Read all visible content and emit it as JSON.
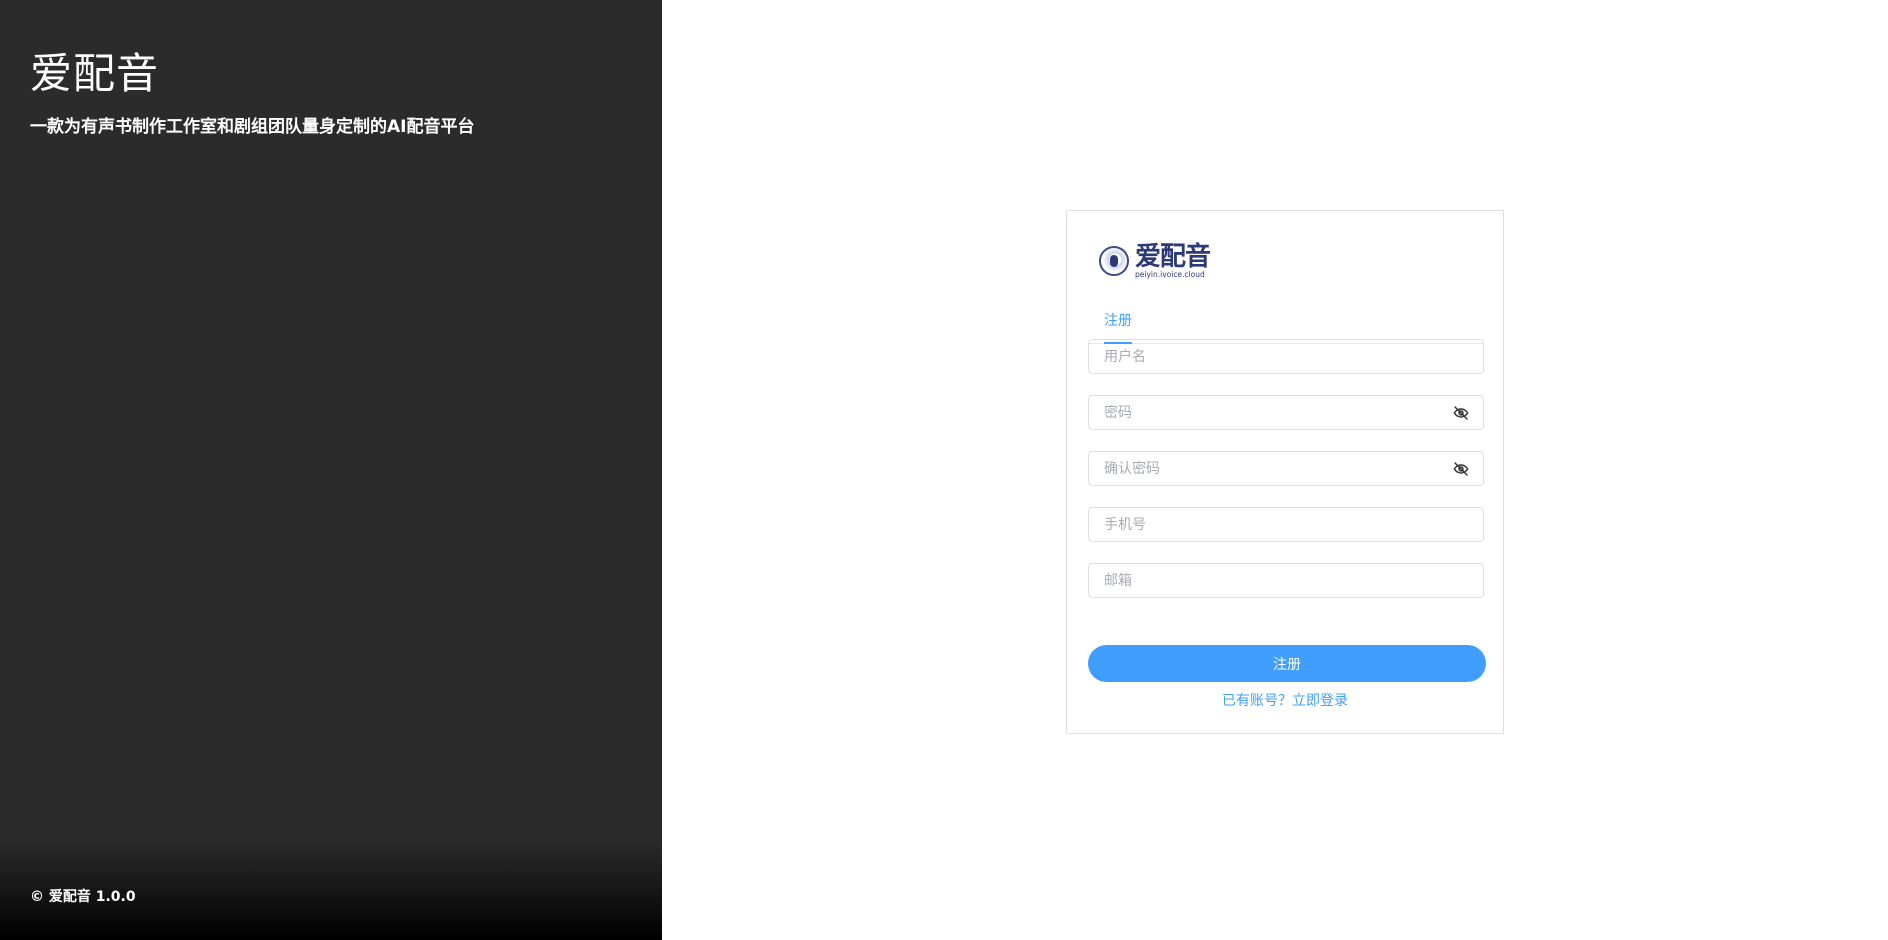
{
  "brand": {
    "title": "爱配音",
    "subtitle": "一款为有声书制作工作室和剧组团队量身定制的AI配音平台",
    "footer": "© 爱配音 1.0.0"
  },
  "logo": {
    "name": "爱配音",
    "domain": "peiyin.ivoice.cloud"
  },
  "tabs": [
    {
      "label": "注册",
      "active": true
    }
  ],
  "form": {
    "username_placeholder": "用户名",
    "password_placeholder": "密码",
    "confirm_password_placeholder": "确认密码",
    "phone_placeholder": "手机号",
    "email_placeholder": "邮箱",
    "submit_label": "注册",
    "login_link": "已有账号？立即登录"
  },
  "icons": {
    "password_toggle": "eye-off-icon"
  },
  "colors": {
    "left_panel_bg": "#2b2b2b",
    "accent": "#409eff",
    "logo_color": "#2d3a7a"
  }
}
